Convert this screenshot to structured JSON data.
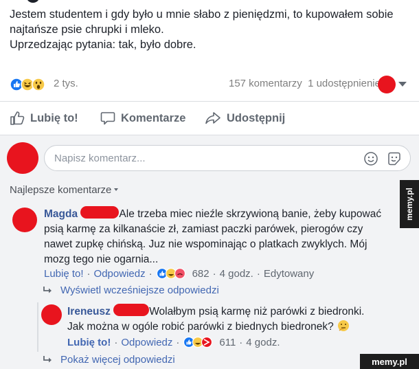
{
  "post": {
    "lines": [
      "Jestem studentem i gdy było u mnie słabo z pieniędzmi, to kupowałem sobie",
      "najtańsze psie chrupki i mleko.",
      "Uprzedzając pytania: tak, było dobre."
    ]
  },
  "stats": {
    "reaction_count": "2 tys.",
    "comments": "157 komentarzy",
    "shares": "1 udostępnienie"
  },
  "actions": {
    "like": "Lubię to!",
    "comment": "Komentarze",
    "share": "Udostępnij"
  },
  "composer": {
    "placeholder": "Napisz komentarz..."
  },
  "sort_label": "Najlepsze komentarze",
  "comments": [
    {
      "name": "Magda",
      "lines": [
        "Ale trzeba miec nieźle skrzywioną banie, żeby kupować",
        "psią karmę za kilkanaście zł, zamiast paczki parówek, pierogów czy",
        "nawet zupkę chińską. Juz nie wspominając o platkach zwyklych. Mój",
        "mozg tego nie ogarnia..."
      ],
      "like": "Lubię to!",
      "reply": "Odpowiedz",
      "reaction_count": "682",
      "time": "4 godz.",
      "edited": "Edytowany"
    }
  ],
  "view_previous": "Wyświetl wcześniejsze odpowiedzi",
  "reply": {
    "name": "Ireneusz",
    "lines": [
      "Wolałbym psią karmę niż parówki z biedronki.",
      "Jak można w ogóle robić parówki z biednych biedronek?"
    ],
    "like": "Lubię to!",
    "reply": "Odpowiedz",
    "reaction_count": "611",
    "time": "4 godz."
  },
  "show_more": "Pokaż więcej odpowiedzi",
  "watermark": {
    "side": "memy.pl",
    "bottom": "memy.pl"
  },
  "colors": {
    "brand_blue": "#4267b2",
    "name_blue": "#385898",
    "censor_red": "#e8141e"
  }
}
